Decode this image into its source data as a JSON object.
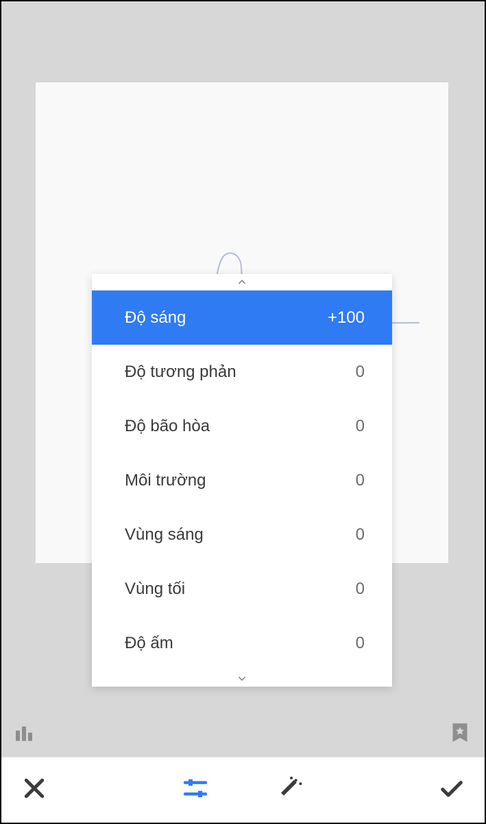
{
  "menu": {
    "items": [
      {
        "label": "Độ sáng",
        "value": "+100",
        "selected": true
      },
      {
        "label": "Độ tương phản",
        "value": "0",
        "selected": false
      },
      {
        "label": "Độ bão hòa",
        "value": "0",
        "selected": false
      },
      {
        "label": "Môi trường",
        "value": "0",
        "selected": false
      },
      {
        "label": "Vùng sáng",
        "value": "0",
        "selected": false
      },
      {
        "label": "Vùng tối",
        "value": "0",
        "selected": false
      },
      {
        "label": "Độ ấm",
        "value": "0",
        "selected": false
      }
    ]
  }
}
